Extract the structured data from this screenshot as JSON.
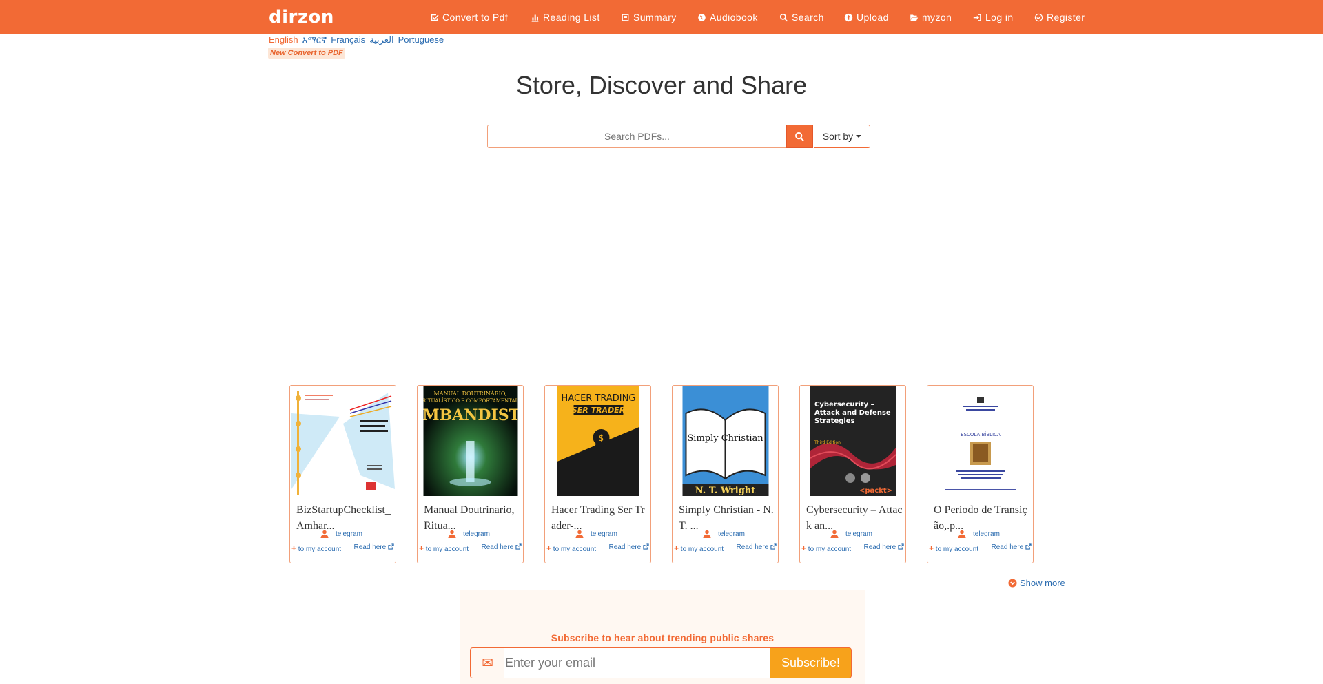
{
  "brand": {
    "logo": "dirzon",
    "accent": "#f26a35"
  },
  "nav": [
    {
      "label": "Convert to Pdf",
      "icon": "check-square-icon"
    },
    {
      "label": "Reading List",
      "icon": "bar-chart-icon"
    },
    {
      "label": "Summary",
      "icon": "list-icon"
    },
    {
      "label": "Audiobook",
      "icon": "globe-icon"
    },
    {
      "label": "Search",
      "icon": "search-icon"
    },
    {
      "label": "Upload",
      "icon": "upload-icon"
    },
    {
      "label": "myzon",
      "icon": "folder-open-icon"
    },
    {
      "label": "Log in",
      "icon": "sign-in-icon"
    },
    {
      "label": "Register",
      "icon": "check-circle-icon"
    }
  ],
  "languages": [
    "English",
    "አማርኛ",
    "Français",
    "العربية",
    "Portuguese"
  ],
  "new_badge": "New Convert to PDF",
  "hero": {
    "title": "Store, Discover and Share"
  },
  "search": {
    "placeholder": "Search PDFs...",
    "sort_label": "Sort by"
  },
  "cards": [
    {
      "title": "BizStartupChecklist_Amhar...",
      "user": "telegram",
      "add_label": "to my account",
      "read_label": "Read here"
    },
    {
      "title": "Manual Doutrinario, Ritua...",
      "user": "telegram",
      "add_label": "to my account",
      "read_label": "Read here",
      "cover_text": [
        "MANUAL DOUTRINÁRIO,",
        "RITUALÍSTICO E COMPORTAMENTAL",
        "UMBANDISTA"
      ]
    },
    {
      "title": "Hacer Trading Ser Trader-...",
      "user": "telegram",
      "add_label": "to my account",
      "read_label": "Read here",
      "cover_text": [
        "HACER TRADING",
        "SER TRADER"
      ]
    },
    {
      "title": "Simply Christian - N. T. ...",
      "user": "telegram",
      "add_label": "to my account",
      "read_label": "Read here",
      "cover_text": [
        "Simply Christian",
        "N. T. Wright"
      ]
    },
    {
      "title": "Cybersecurity – Attack an...",
      "user": "telegram",
      "add_label": "to my account",
      "read_label": "Read here",
      "cover_text": [
        "Cybersecurity –",
        "Attack and Defense",
        "Strategies",
        "Third Edition",
        "<packt>"
      ]
    },
    {
      "title": "O Período de Transição,.p...",
      "user": "telegram",
      "add_label": "to my account",
      "read_label": "Read here",
      "cover_text": [
        "ESCOLA BÍBLICA"
      ]
    }
  ],
  "show_more": "Show more",
  "subscribe": {
    "title": "Subscribe to hear about trending public shares",
    "placeholder": "Enter your email",
    "button": "Subscribe!"
  }
}
